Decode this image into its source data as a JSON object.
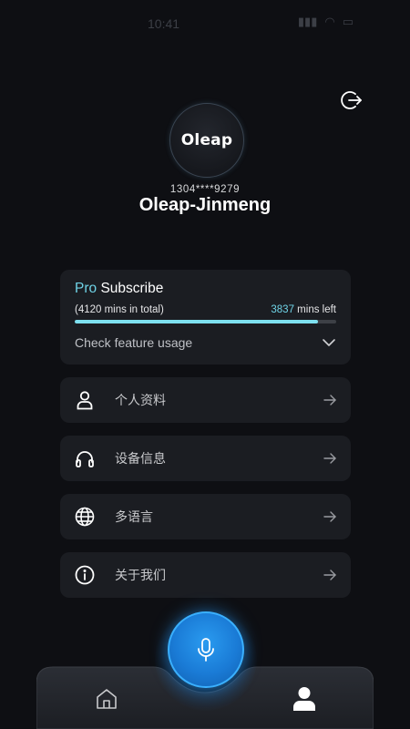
{
  "status_bar": {
    "time": "10:41"
  },
  "profile": {
    "avatar_text": "Oleap",
    "phone": "1304****9279",
    "username": "Oleap-Jinmeng"
  },
  "subscription": {
    "pro_label": "Pro",
    "subscribe_label": "Subscribe",
    "total_text": "(4120 mins in total)",
    "mins_left_value": "3837",
    "mins_left_suffix": " mins left",
    "progress_fraction": 0.931,
    "feature_usage_label": "Check feature usage"
  },
  "menu": [
    {
      "label": "个人资料",
      "icon": "person-icon"
    },
    {
      "label": "设备信息",
      "icon": "headphones-icon"
    },
    {
      "label": "多语言",
      "icon": "globe-icon"
    },
    {
      "label": "关于我们",
      "icon": "info-icon"
    }
  ],
  "colors": {
    "background": "#0e0f13",
    "card": "#1b1d22",
    "accent": "#6fd3e6",
    "mic_blue": "#1a7bd6"
  }
}
